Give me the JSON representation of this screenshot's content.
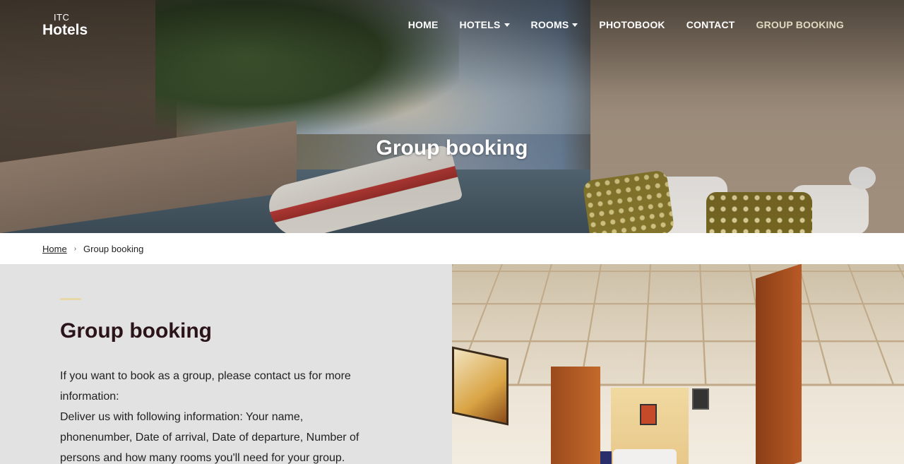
{
  "brand": {
    "logo_small": "ITC",
    "logo_big": "Hotels"
  },
  "nav": {
    "items": [
      {
        "label": "HOME",
        "has_dropdown": false
      },
      {
        "label": "HOTELS",
        "has_dropdown": true
      },
      {
        "label": "ROOMS",
        "has_dropdown": true
      },
      {
        "label": "PHOTOBOOK",
        "has_dropdown": false
      },
      {
        "label": "CONTACT",
        "has_dropdown": false
      },
      {
        "label": "GROUP BOOKING",
        "has_dropdown": false,
        "active": true
      }
    ]
  },
  "hero": {
    "title": "Group booking"
  },
  "breadcrumb": {
    "home": "Home",
    "separator": "›",
    "current": "Group booking"
  },
  "content": {
    "title": "Group booking",
    "paragraph1": "If you want to book as a group, please contact us for more information:",
    "paragraph2": "Deliver us with following information: Your name, phonenumber, Date of arrival, Date of departure, Number of persons and how many rooms you'll need for your group."
  },
  "colors": {
    "accent": "#e8d8a8",
    "active_nav": "#e1d8c0",
    "panel_bg": "#e2e2e2",
    "title_text": "#2a141a"
  }
}
